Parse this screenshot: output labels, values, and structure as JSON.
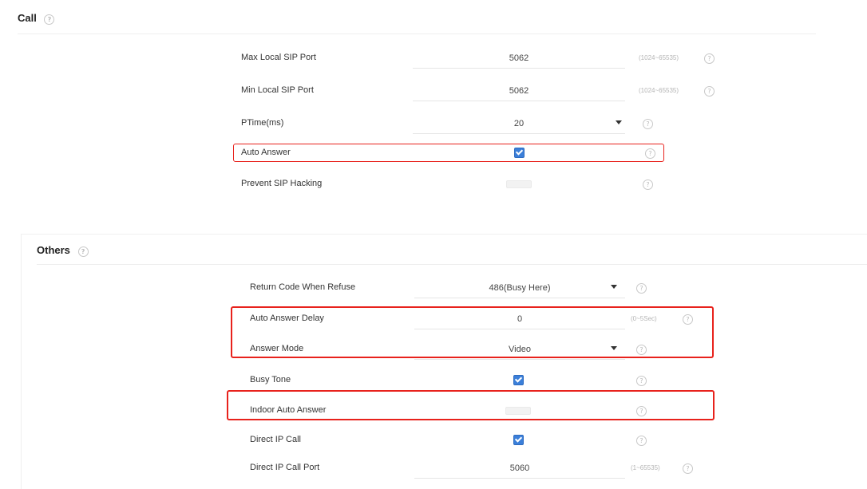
{
  "call": {
    "title": "Call",
    "rows": [
      {
        "label": "Max Local SIP Port",
        "value": "5062",
        "hint": "(1024~65535)"
      },
      {
        "label": "Min Local SIP Port",
        "value": "5062",
        "hint": "(1024~65535)"
      },
      {
        "label": "PTime(ms)",
        "value": "20"
      },
      {
        "label": "Auto Answer",
        "checked": true
      },
      {
        "label": "Prevent SIP Hacking",
        "checked": false
      }
    ]
  },
  "others": {
    "title": "Others",
    "rows": [
      {
        "label": "Return Code When Refuse",
        "value": "486(Busy Here)"
      },
      {
        "label": "Auto Answer Delay",
        "value": "0",
        "hint": "(0~5Sec)"
      },
      {
        "label": "Answer Mode",
        "value": "Video"
      },
      {
        "label": "Busy Tone",
        "checked": true
      },
      {
        "label": "Indoor Auto Answer",
        "checked": false
      },
      {
        "label": "Direct IP Call",
        "checked": true
      },
      {
        "label": "Direct IP Call Port",
        "value": "5060",
        "hint": "(1~65535)"
      }
    ]
  },
  "colors": {
    "highlight": "#e8221c",
    "checkbox": "#3b7fd9"
  },
  "icons": {
    "help": "question-circle-icon",
    "dropdown": "caret-down-icon",
    "check": "checkmark-icon"
  }
}
